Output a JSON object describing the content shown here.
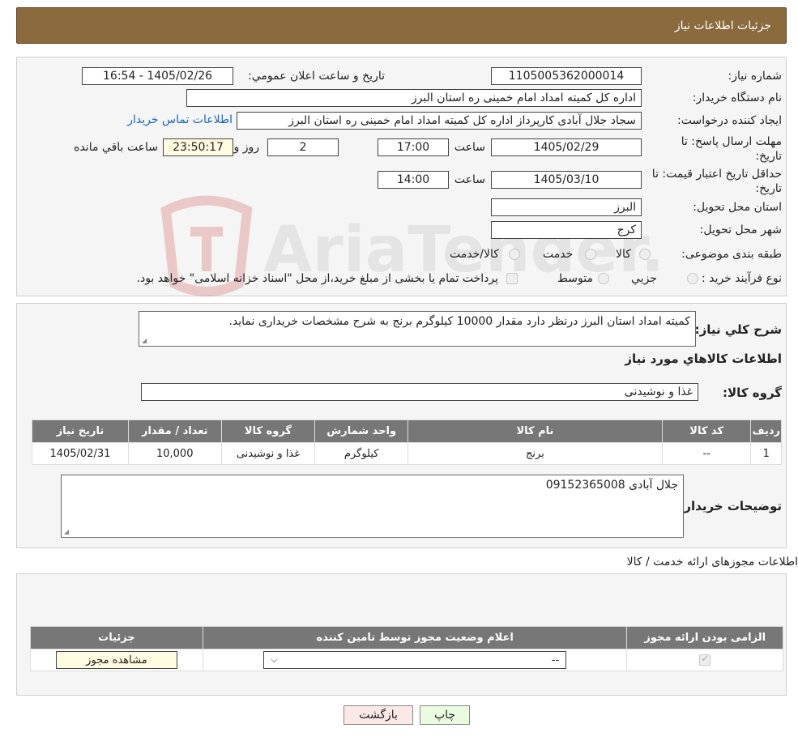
{
  "header": {
    "title": "جزئیات اطلاعات نیاز"
  },
  "form": {
    "need_number_label": "شماره نیاز:",
    "need_number": "1105005362000014",
    "announce_label": "تاریخ و ساعت اعلان عمومي:",
    "announce_value": "1405/02/26 - 16:54",
    "buyer_org_label": "نام دستگاه خریدار:",
    "buyer_org": "اداره کل کمیته امداد امام خمینی  ره  استان البرز",
    "creator_label": "ایجاد کننده درخواست:",
    "creator": "سجاد جلال آبادی کارپرداز اداره کل کمیته امداد امام خمینی  ره  استان البرز",
    "contact_link": "اطلاعات تماس خریدار",
    "reply_deadline_label": "مهلت ارسال پاسخ: تا تاریخ:",
    "reply_date": "1405/02/29",
    "time_label": "ساعت",
    "reply_time": "17:00",
    "days_value": "2",
    "days_label": "روز و",
    "remaining_time": "23:50:17",
    "remaining_label": "ساعت باقي مانده",
    "validity_label": "حداقل تاریخ اعتبار قیمت: تا تاریخ:",
    "validity_date": "1405/03/10",
    "validity_time": "14:00",
    "province_label": "استان محل تحویل:",
    "province": "البرز",
    "city_label": "شهر محل تحویل:",
    "city": "کرج",
    "category_label": "طبقه بندی موضوعی:",
    "category_options": [
      "کالا",
      "خدمت",
      "کالا/خدمت"
    ],
    "process_label": "نوع فرآیند خرید :",
    "process_options": [
      "جزیي",
      "متوسط"
    ],
    "process_note": "پرداخت تمام یا بخشی از مبلغ خرید،از محل \"اسناد خزانه اسلامی\" خواهد بود."
  },
  "description": {
    "label": "شرح کلي نیاز:",
    "text": "کمیته امداد استان البرز درنظر دارد مقدار 10000 کیلوگرم برنج به شرح مشخصات خریداری نماید."
  },
  "goods": {
    "section_title": "اطلاعات کالاهاي مورد نیاز",
    "group_label": "گروه کالا:",
    "group_value": "غذا و نوشیدنی",
    "columns": [
      "ردیف",
      "کد کالا",
      "نام کالا",
      "واحد شمارش",
      "گروه کالا",
      "تعداد / مقدار",
      "تاریخ نیاز"
    ],
    "rows": [
      [
        "1",
        "--",
        "برنج",
        "کیلوگرم",
        "غذا و نوشیدنی",
        "10,000",
        "1405/02/31"
      ]
    ],
    "buyer_notes_label": "توضیحات خریدار:",
    "buyer_notes": "جلال آبادی 09152365008"
  },
  "permits": {
    "section_title": "اطلاعات مجوزهای ارائه خدمت / کالا",
    "columns": [
      "الزامی بودن ارائه مجوز",
      "اعلام وضعیت مجوز توسط تامین کننده",
      "جزئیات"
    ],
    "select_value": "--",
    "view_button": "مشاهده مجوز"
  },
  "buttons": {
    "print": "چاپ",
    "back": "بازگشت"
  },
  "watermark": {
    "text": "AriaTender.neT"
  },
  "colors": {
    "header_bg": "#8b6a3e",
    "link": "#1565c0",
    "table_head": "#777777",
    "print_bg": "#eafbe0",
    "back_bg": "#fde8e8"
  }
}
